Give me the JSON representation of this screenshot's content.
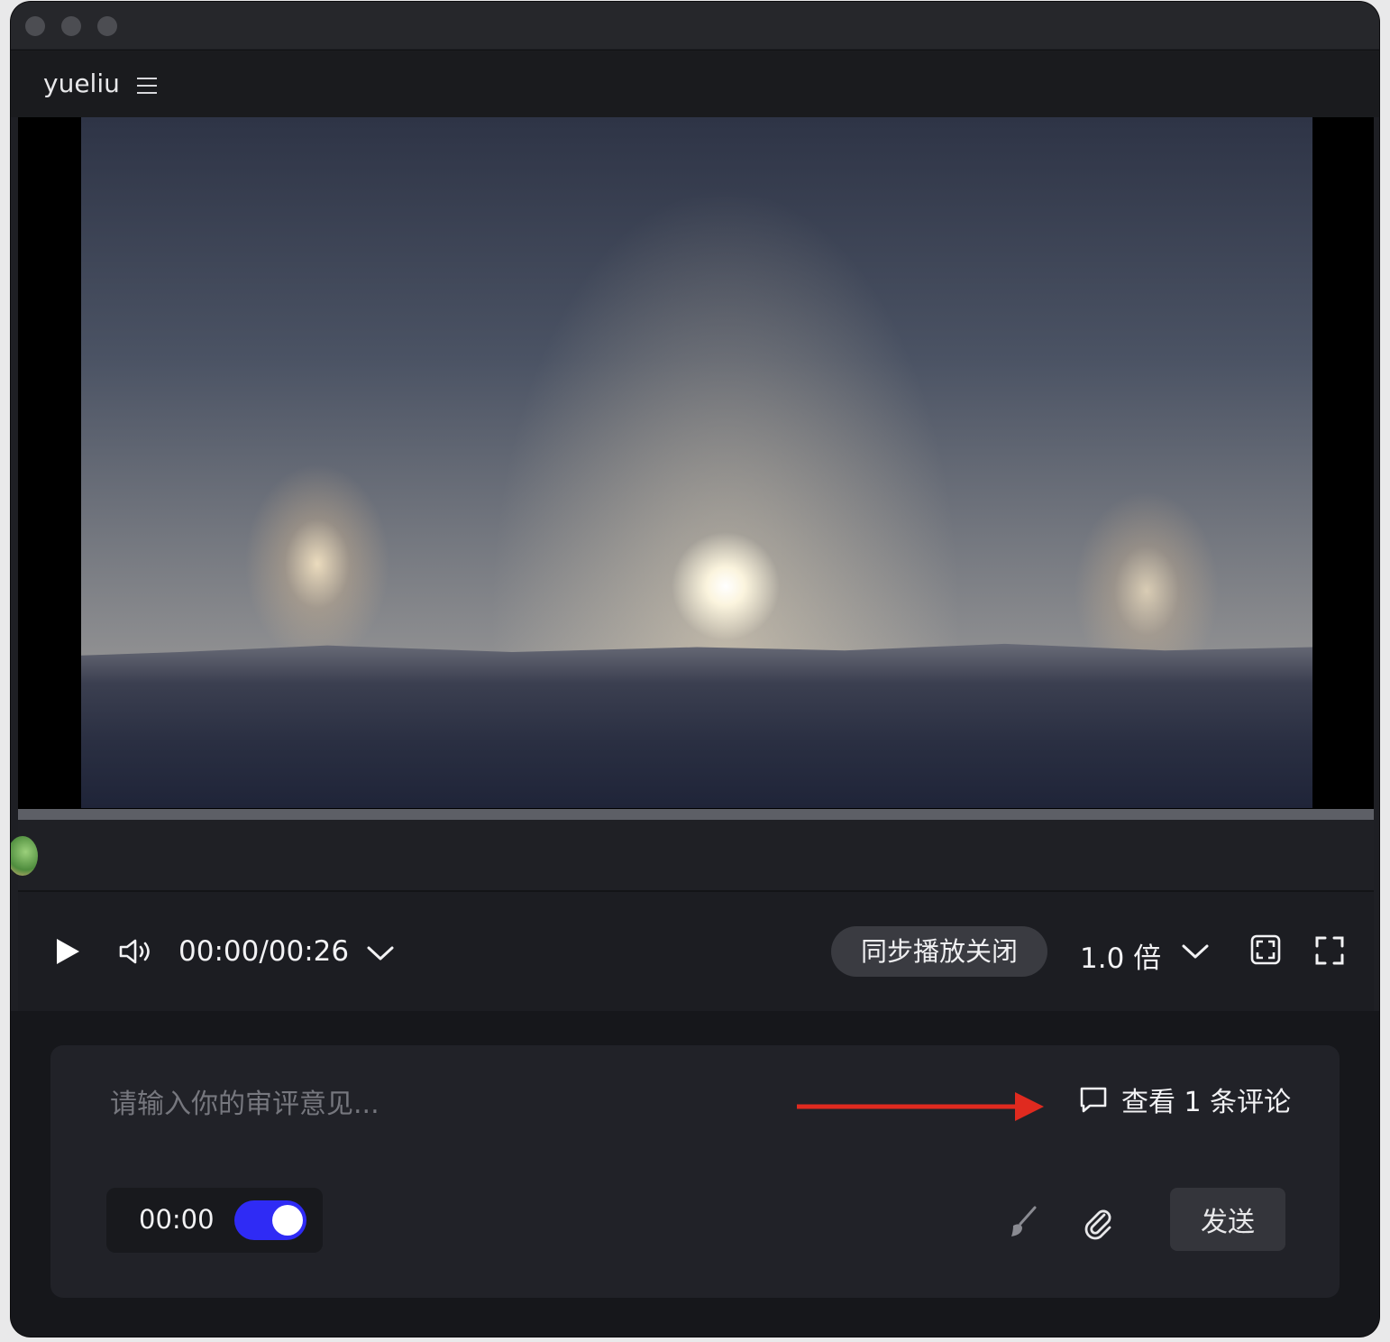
{
  "app": {
    "name": "yueliu"
  },
  "player": {
    "timecode": "00:00/00:26",
    "sync_label": "同步播放关闭",
    "speed_label": "1.0 倍"
  },
  "comment": {
    "placeholder": "请输入你的审评意见...",
    "view_comments": "查看 1 条评论",
    "timestamp": "00:00",
    "timestamp_toggle_on": true,
    "send_label": "发送"
  },
  "colors": {
    "toggle_on": "#2f2bf5",
    "annotation_arrow": "#e02a1f"
  },
  "icons": [
    "menu-icon",
    "play-icon",
    "volume-icon",
    "chevron-down-icon",
    "fit-screen-icon",
    "fullscreen-icon",
    "comment-icon",
    "brush-icon",
    "paperclip-icon"
  ]
}
